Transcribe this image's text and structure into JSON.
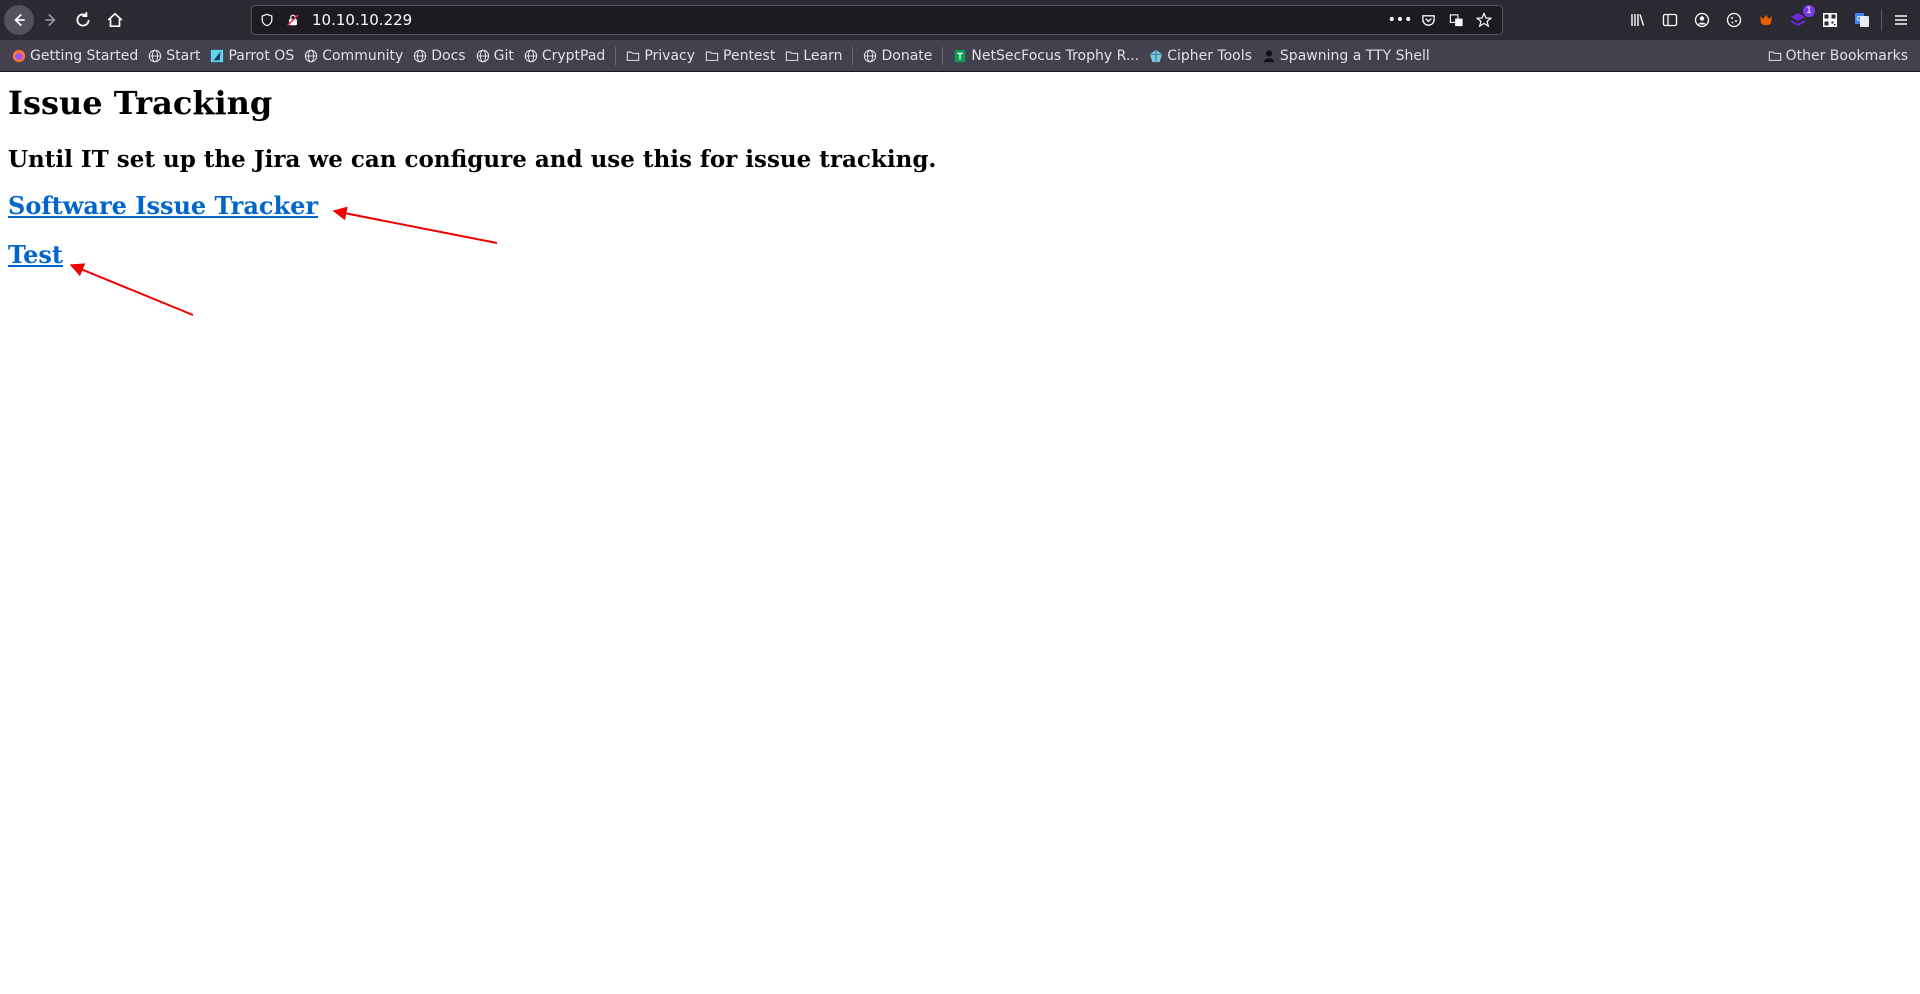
{
  "browser": {
    "url": "10.10.10.229",
    "bookmarks": [
      {
        "label": "Getting Started",
        "icon": "firefox-icon"
      },
      {
        "label": "Start",
        "icon": "globe-icon"
      },
      {
        "label": "Parrot OS",
        "icon": "parrot-icon"
      },
      {
        "label": "Community",
        "icon": "globe-icon"
      },
      {
        "label": "Docs",
        "icon": "globe-icon"
      },
      {
        "label": "Git",
        "icon": "globe-icon"
      },
      {
        "label": "CryptPad",
        "icon": "globe-icon"
      },
      {
        "label": "Privacy",
        "icon": "folder-icon"
      },
      {
        "label": "Pentest",
        "icon": "folder-icon"
      },
      {
        "label": "Learn",
        "icon": "folder-icon"
      },
      {
        "label": "Donate",
        "icon": "globe-icon"
      },
      {
        "label": "NetSecFocus Trophy R...",
        "icon": "sheets-icon"
      },
      {
        "label": "Cipher Tools",
        "icon": "cipher-icon"
      },
      {
        "label": "Spawning a TTY Shell",
        "icon": "shell-icon"
      }
    ],
    "other_bookmarks": "Other Bookmarks",
    "extension_badge": "1"
  },
  "page": {
    "title": "Issue Tracking",
    "subtitle": "Until IT set up the Jira we can configure and use this for issue tracking.",
    "links": [
      {
        "label": "Software Issue Tracker"
      },
      {
        "label": "Test"
      }
    ]
  },
  "colors": {
    "link": "#0066cc",
    "annotation_arrow": "#ee0000",
    "toolbar": "#2b2a33",
    "bookmarks_bar": "#42414d"
  }
}
